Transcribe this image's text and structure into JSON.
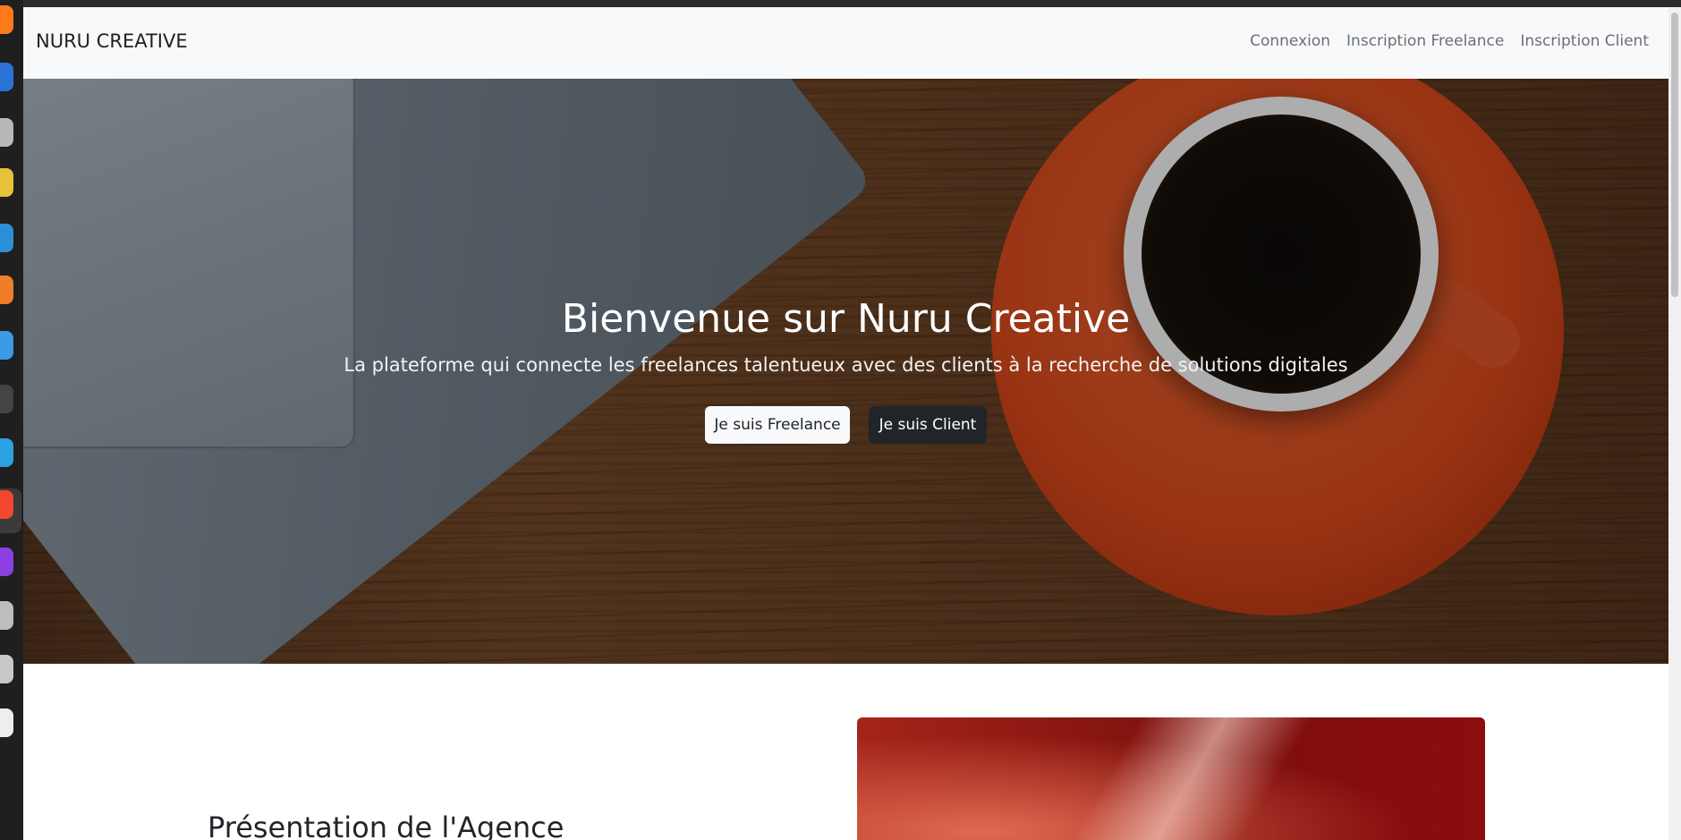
{
  "navbar": {
    "brand": "NURU CREATIVE",
    "links": [
      "Connexion",
      "Inscription Freelance",
      "Inscription Client"
    ]
  },
  "hero": {
    "title": "Bienvenue sur Nuru Creative",
    "subtitle": "La plateforme qui connecte les freelances talentueux avec des clients à la recherche de solutions digitales",
    "buttons": [
      "Je suis Freelance",
      "Je suis Client"
    ]
  },
  "presentation": {
    "title": "Présentation de l'Agence"
  },
  "colors": {
    "navbar_bg": "#f8f9fa",
    "button_dark": "#212529",
    "button_light": "#f8f9fa",
    "accent_orange": "#e24d1d"
  },
  "dock_icons": [
    "firefox-icon",
    "thunderbird-icon",
    "files-icon",
    "rhythmbox-icon",
    "writer-icon",
    "software-icon",
    "help-icon",
    "terminal-icon",
    "telegram-icon",
    "brave-icon",
    "app-icon",
    "trash-icon",
    "usb-icon",
    "apps-grid-icon"
  ]
}
